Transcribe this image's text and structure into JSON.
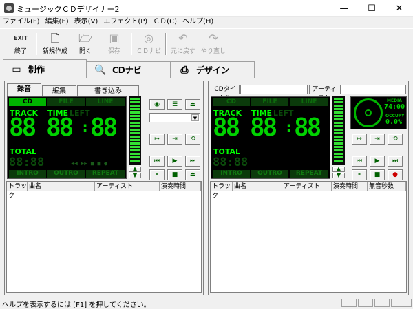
{
  "window": {
    "title": "ミュージックＣＤデザイナー2",
    "minimize": "—",
    "maximize": "☐",
    "close": "✕"
  },
  "menu": [
    "ファイル(F)",
    "編集(E)",
    "表示(V)",
    "エフェクト(P)",
    "ＣＤ(C)",
    "ヘルプ(H)"
  ],
  "toolbar": {
    "exit": {
      "icon_text": "EXIT",
      "label": "終了"
    },
    "new": {
      "label": "新規作成"
    },
    "open": {
      "label": "開く"
    },
    "save": {
      "label": "保存"
    },
    "cdnavi": {
      "label": "ＣＤナビ"
    },
    "undo": {
      "label": "元に戻す"
    },
    "redo": {
      "label": "やり直し"
    }
  },
  "mode_tabs": [
    "制作",
    "CDナビ",
    "デザイン"
  ],
  "left_panel": {
    "tabs": [
      "録音",
      "編集",
      "書き込み"
    ],
    "sources": [
      "CD",
      "FILE",
      "LINE"
    ],
    "track_label": "TRACK",
    "time_label": "TIME",
    "left_label": "LEFT",
    "track_digits": "88",
    "time_digits": "88",
    "time_digits2": "88",
    "total_label": "TOTAL",
    "total_digits": "88:88",
    "mini_controls": "◀◀ ▶▶ ■ ■ ●",
    "bottom_buttons": [
      "INTRO",
      "OUTRO",
      "REPEAT"
    ],
    "columns": [
      "トラック",
      "曲名",
      "アーティスト",
      "演奏時間"
    ]
  },
  "right_panel": {
    "cd_title_label": "CDタイトル",
    "artist_label": "アーティスト",
    "sources": [
      "CD",
      "FILE",
      "LINE"
    ],
    "track_label": "TRACK",
    "time_label": "TIME",
    "left_label": "LEFT",
    "track_digits": "88",
    "time_digits": "88",
    "time_digits2": "88",
    "total_label": "TOTAL",
    "total_digits": "88:88",
    "bottom_buttons": [
      "INTRO",
      "OUTRO",
      "REPEAT"
    ],
    "media_label": "MEDIA",
    "media_time": "74:00",
    "occupy_label": "OCCUPY",
    "occupy_value": "0.0%",
    "columns": [
      "トラック",
      "曲名",
      "アーティスト",
      "演奏時間",
      "無音秒数"
    ]
  },
  "statusbar": {
    "text": "ヘルプを表示するには [F1] を押してください。"
  },
  "colors": {
    "lcd_green": "#00d200",
    "lcd_dim": "#0b4a0b",
    "window_bg": "#f0f0f0"
  }
}
